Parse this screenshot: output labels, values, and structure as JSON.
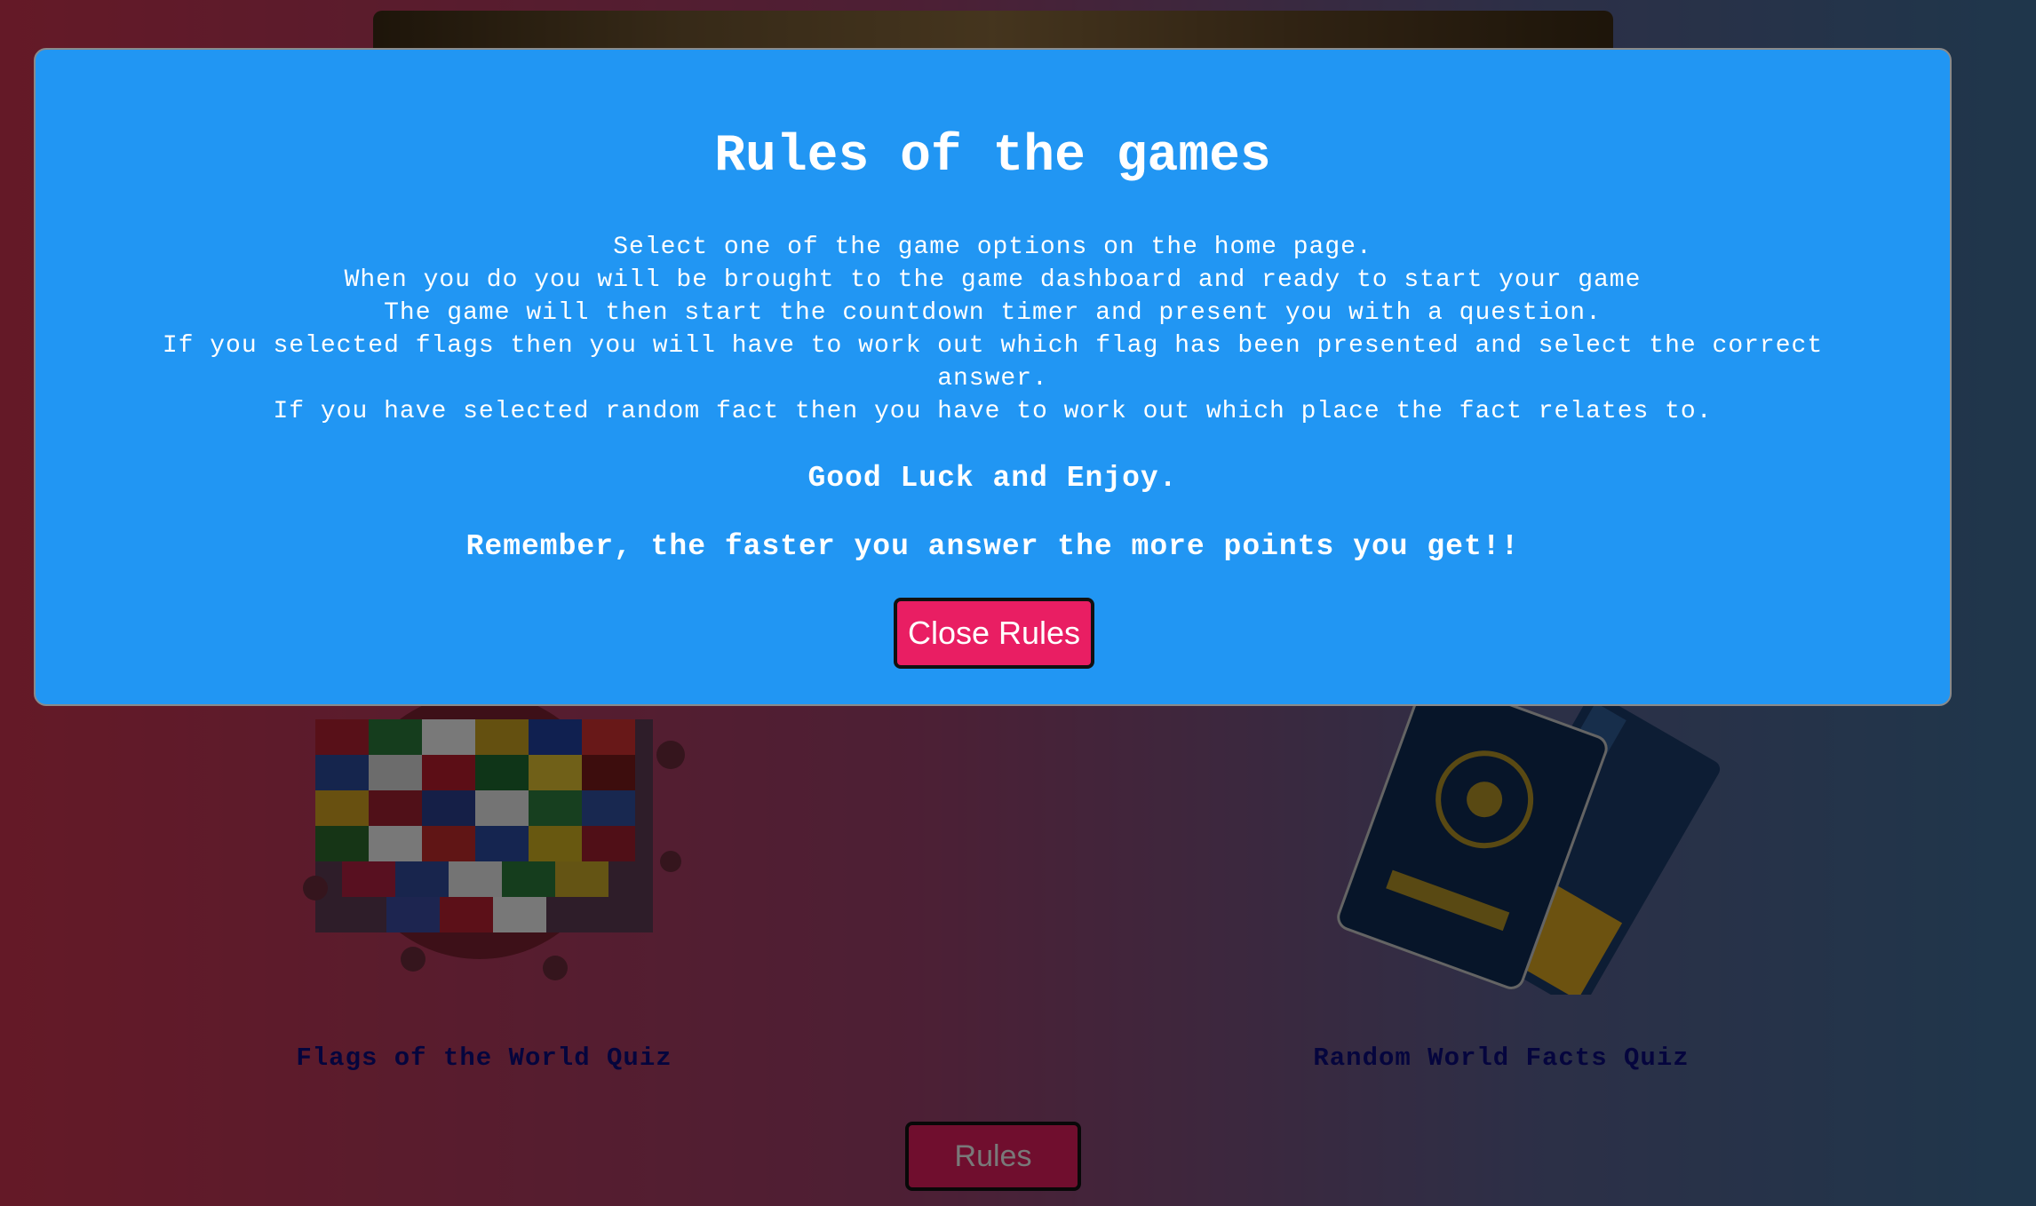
{
  "background": {
    "cards": [
      {
        "title": "Flags of the World Quiz",
        "image": "flags-collage"
      },
      {
        "title": "Random World Facts Quiz",
        "image": "passport-ticket"
      }
    ],
    "rules_button_label": "Rules"
  },
  "modal": {
    "title": "Rules of the games",
    "lines": [
      "Select one of the game options on the home page.",
      "When you do you will be brought to the game dashboard and ready to start your game",
      "The game will then start the countdown timer and present you with a question.",
      "If you selected flags then you will have to work out which flag has been presented and select the correct answer.",
      "If you have selected random fact then you have to work out which place the fact relates to."
    ],
    "good_luck": "Good Luck and Enjoy.",
    "remember": "Remember, the faster you answer the more points you get!!",
    "close_label": "Close Rules"
  },
  "colors": {
    "modal_bg": "#2196f3",
    "button_bg": "#e91e63",
    "card_title": "#0b0b7a"
  }
}
